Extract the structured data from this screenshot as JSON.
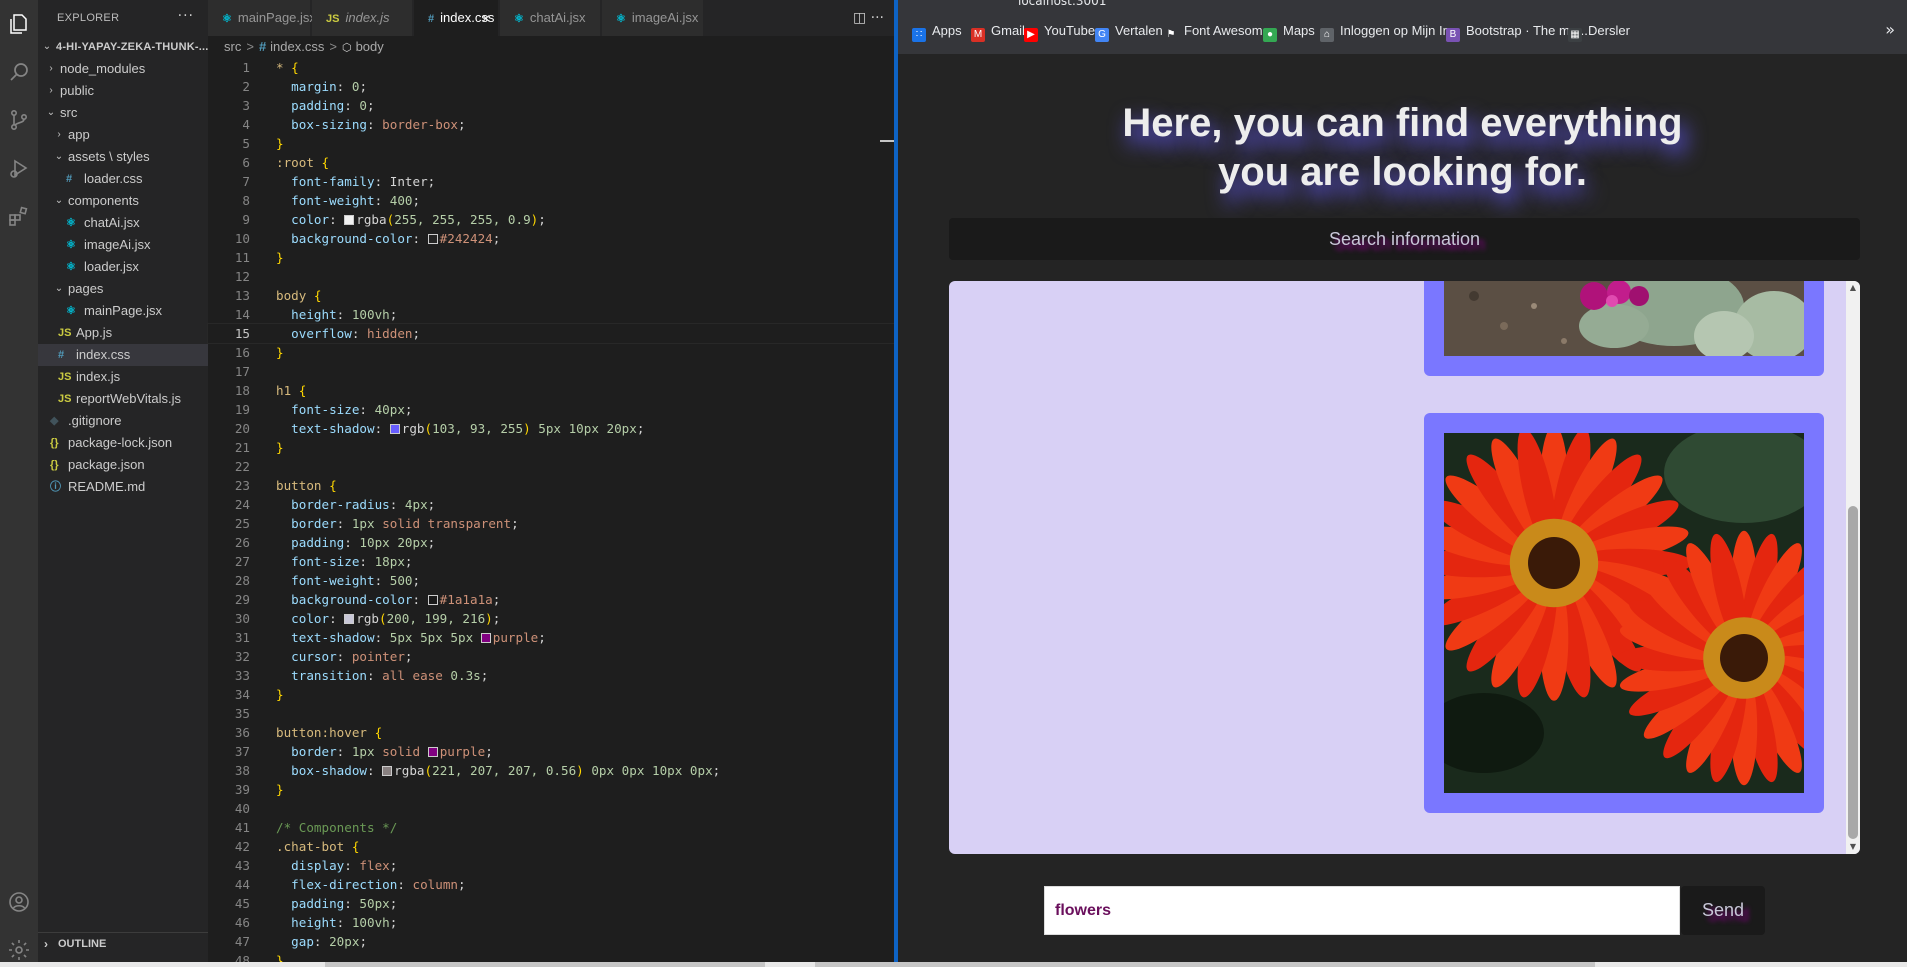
{
  "vscode": {
    "explorer_title": "EXPLORER",
    "more_actions": "···",
    "tree": [
      {
        "label": "4-HI-YAPAY-ZEKA-THUNK-...",
        "depth": 0,
        "chev": "⌄",
        "icon": "",
        "kind": "root"
      },
      {
        "label": "node_modules",
        "depth": 1,
        "chev": "›",
        "icon": "",
        "kind": "folder"
      },
      {
        "label": "public",
        "depth": 1,
        "chev": "›",
        "icon": "",
        "kind": "folder"
      },
      {
        "label": "src",
        "depth": 1,
        "chev": "⌄",
        "icon": "",
        "kind": "folder"
      },
      {
        "label": "app",
        "depth": 2,
        "chev": "›",
        "icon": "",
        "kind": "folder"
      },
      {
        "label": "assets \\ styles",
        "depth": 2,
        "chev": "⌄",
        "icon": "",
        "kind": "folder"
      },
      {
        "label": "loader.css",
        "depth": 3,
        "chev": "",
        "icon": "#",
        "kind": "css"
      },
      {
        "label": "components",
        "depth": 2,
        "chev": "⌄",
        "icon": "",
        "kind": "folder"
      },
      {
        "label": "chatAi.jsx",
        "depth": 3,
        "chev": "",
        "icon": "⚛",
        "kind": "jsx"
      },
      {
        "label": "imageAi.jsx",
        "depth": 3,
        "chev": "",
        "icon": "⚛",
        "kind": "jsx"
      },
      {
        "label": "loader.jsx",
        "depth": 3,
        "chev": "",
        "icon": "⚛",
        "kind": "jsx"
      },
      {
        "label": "pages",
        "depth": 2,
        "chev": "⌄",
        "icon": "",
        "kind": "folder"
      },
      {
        "label": "mainPage.jsx",
        "depth": 3,
        "chev": "",
        "icon": "⚛",
        "kind": "jsx"
      },
      {
        "label": "App.js",
        "depth": 2,
        "chev": "",
        "icon": "JS",
        "kind": "js"
      },
      {
        "label": "index.css",
        "depth": 2,
        "chev": "",
        "icon": "#",
        "kind": "css",
        "selected": true
      },
      {
        "label": "index.js",
        "depth": 2,
        "chev": "",
        "icon": "JS",
        "kind": "js"
      },
      {
        "label": "reportWebVitals.js",
        "depth": 2,
        "chev": "",
        "icon": "JS",
        "kind": "js"
      },
      {
        "label": ".gitignore",
        "depth": 1,
        "chev": "",
        "icon": "◆",
        "kind": "git"
      },
      {
        "label": "package-lock.json",
        "depth": 1,
        "chev": "",
        "icon": "{}",
        "kind": "json"
      },
      {
        "label": "package.json",
        "depth": 1,
        "chev": "",
        "icon": "{}",
        "kind": "json"
      },
      {
        "label": "README.md",
        "depth": 1,
        "chev": "",
        "icon": "ⓘ",
        "kind": "md"
      }
    ],
    "outline_label": "OUTLINE",
    "outline_chev": "›",
    "tabs": [
      {
        "label": "mainPage.jsx",
        "icon": "⚛",
        "kind": "jsx",
        "italic": false
      },
      {
        "label": "index.js",
        "icon": "JS",
        "kind": "js",
        "italic": true
      },
      {
        "label": "index.css",
        "icon": "#",
        "kind": "css",
        "italic": false,
        "active": true
      },
      {
        "label": "chatAi.jsx",
        "icon": "⚛",
        "kind": "jsx",
        "italic": false
      },
      {
        "label": "imageAi.jsx",
        "icon": "⚛",
        "kind": "jsx",
        "italic": false
      }
    ],
    "tab_close": "×",
    "tab_actions": "◫   ···",
    "breadcrumb": [
      "src",
      "index.css",
      "body"
    ],
    "breadcrumb_sep": ">",
    "current_line": 15,
    "code": [
      [
        [
          "* ",
          "sel"
        ],
        [
          "{",
          "br"
        ]
      ],
      [
        [
          "  margin",
          "prop"
        ],
        [
          ": ",
          "pun"
        ],
        [
          "0",
          "num"
        ],
        [
          ";",
          "pun"
        ]
      ],
      [
        [
          "  padding",
          "prop"
        ],
        [
          ": ",
          "pun"
        ],
        [
          "0",
          "num"
        ],
        [
          ";",
          "pun"
        ]
      ],
      [
        [
          "  box-sizing",
          "prop"
        ],
        [
          ": ",
          "pun"
        ],
        [
          "border-box",
          "val"
        ],
        [
          ";",
          "pun"
        ]
      ],
      [
        [
          "}",
          "br"
        ]
      ],
      [
        [
          ":root ",
          "sel"
        ],
        [
          "{",
          "br"
        ]
      ],
      [
        [
          "  font-family",
          "prop"
        ],
        [
          ": ",
          "pun"
        ],
        [
          "Inter",
          "pun"
        ],
        [
          ";",
          "pun"
        ]
      ],
      [
        [
          "  font-weight",
          "prop"
        ],
        [
          ": ",
          "pun"
        ],
        [
          "400",
          "num"
        ],
        [
          ";",
          "pun"
        ]
      ],
      [
        [
          "  color",
          "prop"
        ],
        [
          ": ",
          "pun"
        ],
        [
          "#fffffff0",
          "swatch"
        ],
        [
          "rgba",
          "pun"
        ],
        [
          "(",
          "br2"
        ],
        [
          "255, 255, 255, 0.9",
          "num"
        ],
        [
          ")",
          "br2"
        ],
        [
          ";",
          "pun"
        ]
      ],
      [
        [
          "  background-color",
          "prop"
        ],
        [
          ": ",
          "pun"
        ],
        [
          "#242424",
          "swatch"
        ],
        [
          "#242424",
          "val"
        ],
        [
          ";",
          "pun"
        ]
      ],
      [
        [
          "}",
          "br"
        ]
      ],
      [],
      [
        [
          "body ",
          "sel"
        ],
        [
          "{",
          "br"
        ]
      ],
      [
        [
          "  height",
          "prop"
        ],
        [
          ": ",
          "pun"
        ],
        [
          "100vh",
          "num"
        ],
        [
          ";",
          "pun"
        ]
      ],
      [
        [
          "  overflow",
          "prop"
        ],
        [
          ": ",
          "pun"
        ],
        [
          "hidden",
          "val"
        ],
        [
          ";",
          "pun"
        ]
      ],
      [
        [
          "}",
          "br"
        ]
      ],
      [],
      [
        [
          "h1 ",
          "sel"
        ],
        [
          "{",
          "br"
        ]
      ],
      [
        [
          "  font-size",
          "prop"
        ],
        [
          ": ",
          "pun"
        ],
        [
          "40px",
          "num"
        ],
        [
          ";",
          "pun"
        ]
      ],
      [
        [
          "  text-shadow",
          "prop"
        ],
        [
          ": ",
          "pun"
        ],
        [
          "#675dff",
          "swatch"
        ],
        [
          "rgb",
          "pun"
        ],
        [
          "(",
          "br2"
        ],
        [
          "103, 93, 255",
          "num"
        ],
        [
          ")",
          "br2"
        ],
        [
          " 5px 10px 20px",
          "num"
        ],
        [
          ";",
          "pun"
        ]
      ],
      [
        [
          "}",
          "br"
        ]
      ],
      [],
      [
        [
          "button ",
          "sel"
        ],
        [
          "{",
          "br"
        ]
      ],
      [
        [
          "  border-radius",
          "prop"
        ],
        [
          ": ",
          "pun"
        ],
        [
          "4px",
          "num"
        ],
        [
          ";",
          "pun"
        ]
      ],
      [
        [
          "  border",
          "prop"
        ],
        [
          ": ",
          "pun"
        ],
        [
          "1px ",
          "num"
        ],
        [
          "solid transparent",
          "val"
        ],
        [
          ";",
          "pun"
        ]
      ],
      [
        [
          "  padding",
          "prop"
        ],
        [
          ": ",
          "pun"
        ],
        [
          "10px 20px",
          "num"
        ],
        [
          ";",
          "pun"
        ]
      ],
      [
        [
          "  font-size",
          "prop"
        ],
        [
          ": ",
          "pun"
        ],
        [
          "18px",
          "num"
        ],
        [
          ";",
          "pun"
        ]
      ],
      [
        [
          "  font-weight",
          "prop"
        ],
        [
          ": ",
          "pun"
        ],
        [
          "500",
          "num"
        ],
        [
          ";",
          "pun"
        ]
      ],
      [
        [
          "  background-color",
          "prop"
        ],
        [
          ": ",
          "pun"
        ],
        [
          "#1a1a1a",
          "swatch"
        ],
        [
          "#1a1a1a",
          "val"
        ],
        [
          ";",
          "pun"
        ]
      ],
      [
        [
          "  color",
          "prop"
        ],
        [
          ": ",
          "pun"
        ],
        [
          "#c8c7d8",
          "swatch"
        ],
        [
          "rgb",
          "pun"
        ],
        [
          "(",
          "br2"
        ],
        [
          "200, 199, 216",
          "num"
        ],
        [
          ")",
          "br2"
        ],
        [
          ";",
          "pun"
        ]
      ],
      [
        [
          "  text-shadow",
          "prop"
        ],
        [
          ": ",
          "pun"
        ],
        [
          "5px 5px 5px ",
          "num"
        ],
        [
          "#800080",
          "swatch"
        ],
        [
          "purple",
          "val"
        ],
        [
          ";",
          "pun"
        ]
      ],
      [
        [
          "  cursor",
          "prop"
        ],
        [
          ": ",
          "pun"
        ],
        [
          "pointer",
          "val"
        ],
        [
          ";",
          "pun"
        ]
      ],
      [
        [
          "  transition",
          "prop"
        ],
        [
          ": ",
          "pun"
        ],
        [
          "all ease ",
          "val"
        ],
        [
          "0.3s",
          "num"
        ],
        [
          ";",
          "pun"
        ]
      ],
      [
        [
          "}",
          "br"
        ]
      ],
      [],
      [
        [
          "button:hover ",
          "sel"
        ],
        [
          "{",
          "br"
        ]
      ],
      [
        [
          "  border",
          "prop"
        ],
        [
          ": ",
          "pun"
        ],
        [
          "1px ",
          "num"
        ],
        [
          "solid ",
          "val"
        ],
        [
          "#800080",
          "swatch"
        ],
        [
          "purple",
          "val"
        ],
        [
          ";",
          "pun"
        ]
      ],
      [
        [
          "  box-shadow",
          "prop"
        ],
        [
          ": ",
          "pun"
        ],
        [
          "#ddcfcf8f",
          "swatch"
        ],
        [
          "rgba",
          "pun"
        ],
        [
          "(",
          "br2"
        ],
        [
          "221, 207, 207, 0.56",
          "num"
        ],
        [
          ")",
          "br2"
        ],
        [
          " 0px 0px 10px 0px",
          "num"
        ],
        [
          ";",
          "pun"
        ]
      ],
      [
        [
          "}",
          "br"
        ]
      ],
      [],
      [
        [
          "/* Components */",
          "cmt"
        ]
      ],
      [
        [
          ".chat-bot ",
          "sel"
        ],
        [
          "{",
          "br"
        ]
      ],
      [
        [
          "  display",
          "prop"
        ],
        [
          ": ",
          "pun"
        ],
        [
          "flex",
          "val"
        ],
        [
          ";",
          "pun"
        ]
      ],
      [
        [
          "  flex-direction",
          "prop"
        ],
        [
          ": ",
          "pun"
        ],
        [
          "column",
          "val"
        ],
        [
          ";",
          "pun"
        ]
      ],
      [
        [
          "  padding",
          "prop"
        ],
        [
          ": ",
          "pun"
        ],
        [
          "50px",
          "num"
        ],
        [
          ";",
          "pun"
        ]
      ],
      [
        [
          "  height",
          "prop"
        ],
        [
          ": ",
          "pun"
        ],
        [
          "100vh",
          "num"
        ],
        [
          ";",
          "pun"
        ]
      ],
      [
        [
          "  gap",
          "prop"
        ],
        [
          ": ",
          "pun"
        ],
        [
          "20px",
          "num"
        ],
        [
          ";",
          "pun"
        ]
      ],
      [
        [
          "}",
          "br"
        ]
      ]
    ]
  },
  "browser": {
    "url": "localhost:3001",
    "bookmarks": [
      {
        "label": "Apps",
        "icon": "∷",
        "color": "#1a73e8"
      },
      {
        "label": "Gmail",
        "icon": "M",
        "color": "#d93025"
      },
      {
        "label": "YouTube",
        "icon": "▶",
        "color": "#ff0000"
      },
      {
        "label": "Vertalen",
        "icon": "G",
        "color": "#4285f4"
      },
      {
        "label": "Font Awesome",
        "icon": "⚑",
        "color": "#35363a"
      },
      {
        "label": "Maps",
        "icon": "●",
        "color": "#34a853"
      },
      {
        "label": "Inloggen op Mijn In...",
        "icon": "⌂",
        "color": "#5f6368"
      },
      {
        "label": "Bootstrap · The mo...",
        "icon": "B",
        "color": "#7952b3"
      },
      {
        "label": "Dersler",
        "icon": "▦",
        "color": "#3c4043"
      }
    ],
    "bookmarks_more": "»",
    "heading_line1": "Here, you can find everything",
    "heading_line2": "you are looking for.",
    "search_button": "Search information",
    "chat_input_value": "flowers",
    "send_button": "Send",
    "scroll_up": "▲",
    "scroll_down": "▼"
  },
  "colors": {
    "results_bg": "#d8d0f5",
    "card_bg": "#7a77ff",
    "hero_shadow": "#675dff",
    "vscode_accent": "#0e63c4"
  }
}
